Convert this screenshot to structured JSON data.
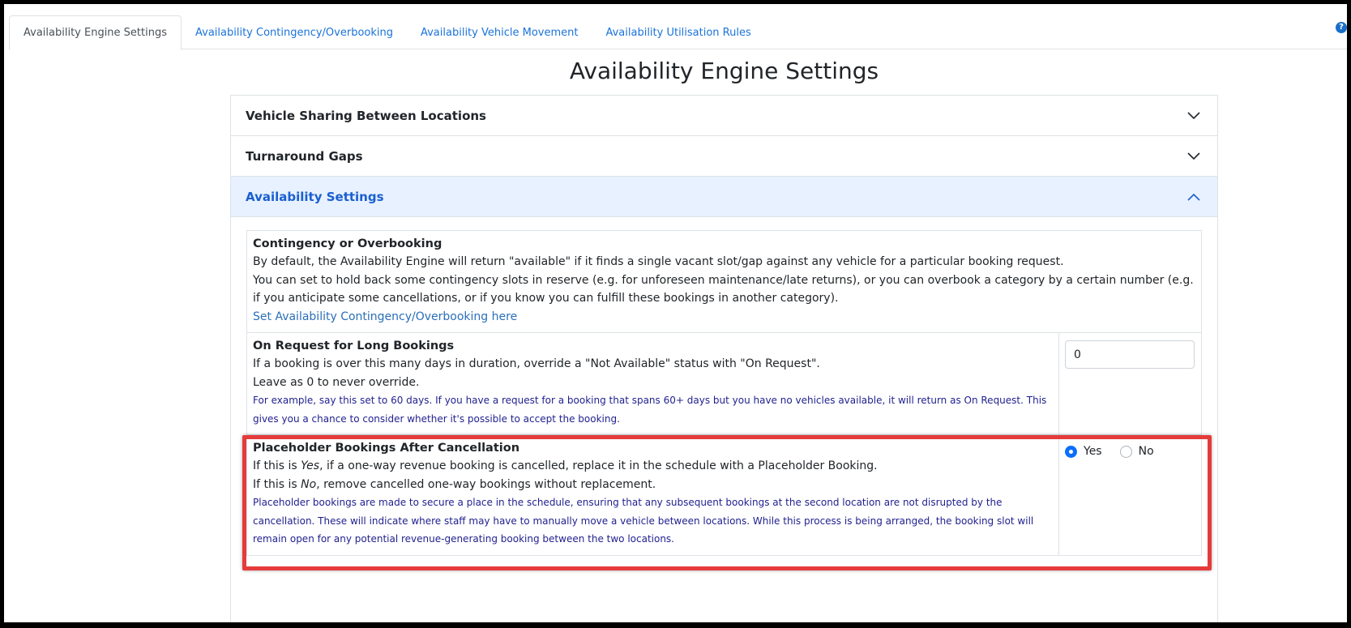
{
  "tabs": [
    {
      "label": "Availability Engine Settings",
      "active": true
    },
    {
      "label": "Availability Contingency/Overbooking",
      "active": false
    },
    {
      "label": "Availability Vehicle Movement",
      "active": false
    },
    {
      "label": "Availability Utilisation Rules",
      "active": false
    }
  ],
  "help_icon": "question-circle-icon",
  "page_title": "Availability Engine Settings",
  "accordion": [
    {
      "label": "Vehicle Sharing Between Locations",
      "open": false
    },
    {
      "label": "Turnaround Gaps",
      "open": false
    },
    {
      "label": "Availability Settings",
      "open": true
    }
  ],
  "settings": {
    "contingency": {
      "title": "Contingency or Overbooking",
      "line1": "By default, the Availability Engine will return \"available\" if it finds a single vacant slot/gap against any vehicle for a particular booking request.",
      "line2": "You can set to hold back some contingency slots in reserve (e.g. for unforeseen maintenance/late returns), or you can overbook a category by a certain number (e.g. if you anticipate some cancellations, or if you know you can fulfill these bookings in another category).",
      "link": "Set Availability Contingency/Overbooking here"
    },
    "on_request": {
      "title": "On Request for Long Bookings",
      "line1": "If a booking is over this many days in duration, override a \"Not Available\" status with \"On Request\".",
      "line2": "Leave as 0 to never override.",
      "note": "For example, say this set to 60 days. If you have a request for a booking that spans 60+ days but you have no vehicles available, it will return as On Request. This gives you a chance to consider whether it's possible to accept the booking.",
      "value": "0"
    },
    "placeholder": {
      "title": "Placeholder Bookings After Cancellation",
      "line1_prefix": "If this is ",
      "line1_em": "Yes",
      "line1_suffix": ", if a one-way revenue booking is cancelled, replace it in the schedule with a Placeholder Booking.",
      "line2_prefix": "If this is ",
      "line2_em": "No",
      "line2_suffix": ", remove cancelled one-way bookings without replacement.",
      "note": "Placeholder bookings are made to secure a place in the schedule, ensuring that any subsequent bookings at the second location are not disrupted by the cancellation. These will indicate where staff may have to manually move a vehicle between locations. While this process is being arranged, the booking slot will remain open for any potential revenue-generating booking between the two locations.",
      "yes_label": "Yes",
      "no_label": "No",
      "selected": "Yes"
    }
  },
  "colors": {
    "accent": "#1a73d9",
    "highlight": "#e53b3b",
    "open_header_bg": "#e7f1ff"
  }
}
